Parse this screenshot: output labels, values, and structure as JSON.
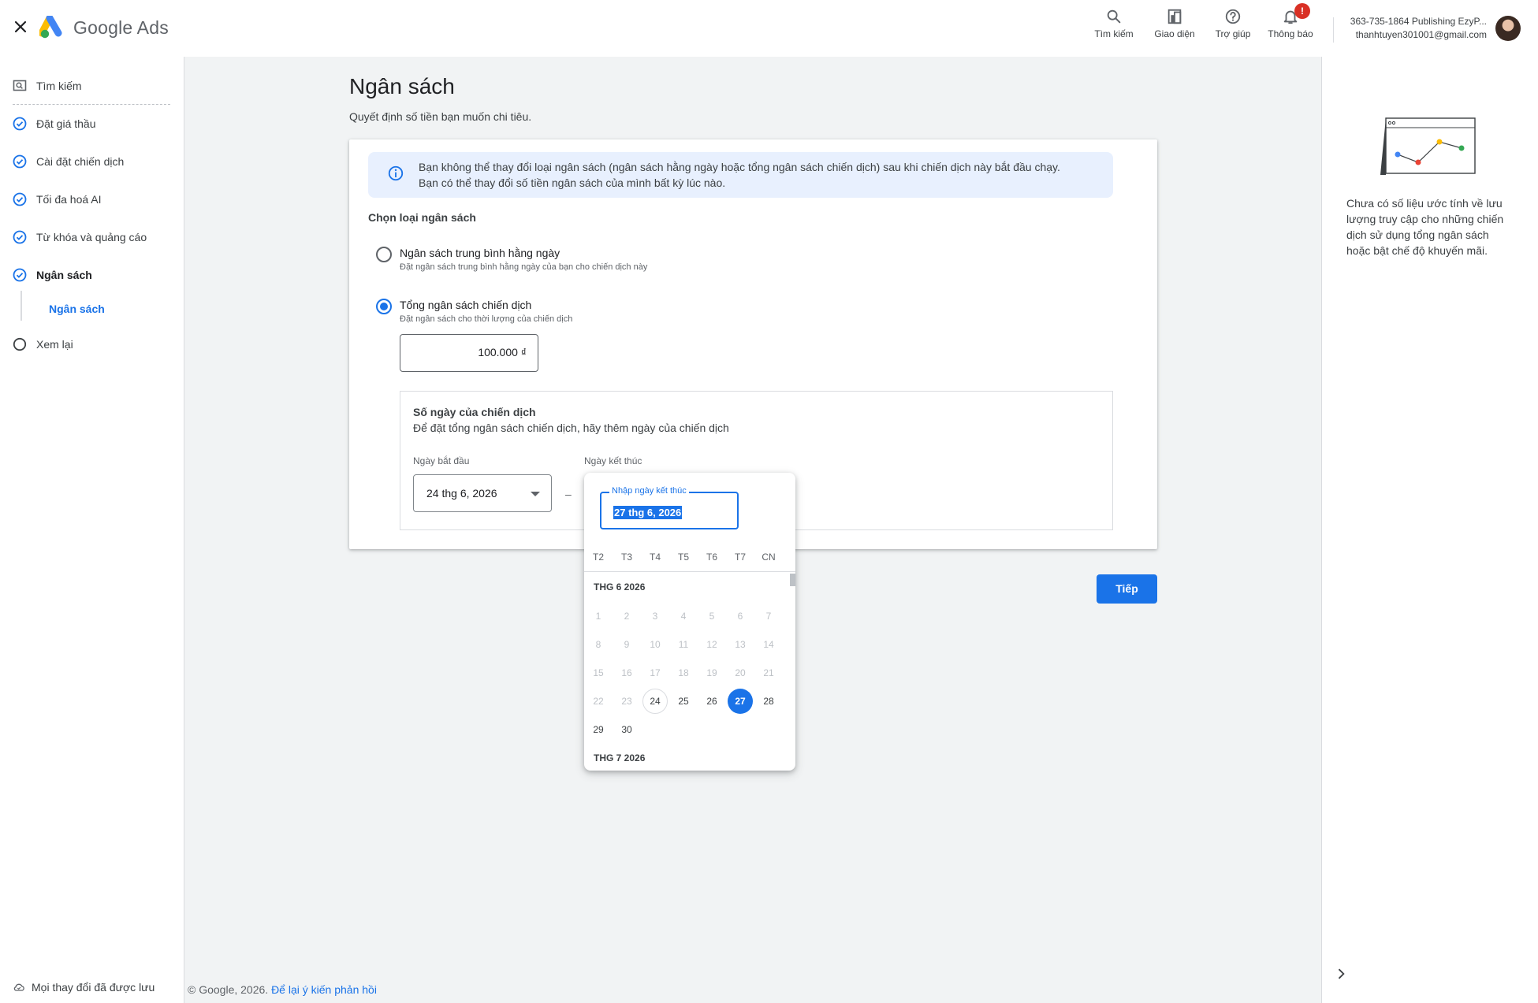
{
  "header": {
    "brand": "Google Ads",
    "actions": [
      {
        "label": "Tìm kiếm",
        "icon": "search-icon"
      },
      {
        "label": "Giao diện",
        "icon": "appearance-icon"
      },
      {
        "label": "Trợ giúp",
        "icon": "help-icon"
      },
      {
        "label": "Thông báo",
        "icon": "bell-icon",
        "badge": "!"
      }
    ],
    "account_name": "363-735-1864 Publishing EzyP...",
    "account_email": "thanhtuyen301001@gmail.com"
  },
  "sidebar": {
    "items": [
      {
        "label": "Tìm kiếm",
        "state": "search"
      },
      {
        "label": "Đặt giá thầu",
        "state": "done"
      },
      {
        "label": "Cài đặt chiến dịch",
        "state": "done"
      },
      {
        "label": "Tối đa hoá AI",
        "state": "done"
      },
      {
        "label": "Từ khóa và quảng cáo",
        "state": "done"
      },
      {
        "label": "Ngân sách",
        "state": "current"
      },
      {
        "label": "Xem lại",
        "state": "todo"
      }
    ],
    "subitem": "Ngân sách",
    "saved_status": "Mọi thay đổi đã được lưu"
  },
  "page": {
    "title": "Ngân sách",
    "subtitle": "Quyết định số tiền bạn muốn chi tiêu.",
    "info_line1": "Bạn không thể thay đổi loại ngân sách (ngân sách hằng ngày hoặc tổng ngân sách chiến dịch) sau khi chiến dịch này bắt đầu chạy.",
    "info_line2": "Bạn có thể thay đổi số tiền ngân sách của mình bất kỳ lúc nào.",
    "section_label": "Chọn loại ngân sách",
    "option1_label": "Ngân sách trung bình hằng ngày",
    "option1_desc": "Đặt ngân sách trung bình hằng ngày của bạn cho chiến dịch này",
    "option2_label": "Tổng ngân sách chiến dịch",
    "option2_desc": "Đặt ngân sách cho thời lượng của chiến dịch",
    "amount": "100.000 ₫",
    "days_title": "Số ngày của chiến dịch",
    "days_desc": "Để đặt tổng ngân sách chiến dịch, hãy thêm ngày của chiến dịch",
    "start_label": "Ngày bắt đầu",
    "end_label": "Ngày kết thúc",
    "start_value": "24 thg 6, 2026",
    "separator": "–",
    "next_button": "Tiếp"
  },
  "datepicker": {
    "input_label": "Nhập ngày kết thúc",
    "input_value": "27 thg 6, 2026",
    "weekdays": [
      "T2",
      "T3",
      "T4",
      "T5",
      "T6",
      "T7",
      "CN"
    ],
    "month1": "THG 6 2026",
    "month2": "THG 7 2026",
    "days": [
      "1",
      "2",
      "3",
      "4",
      "5",
      "6",
      "7",
      "8",
      "9",
      "10",
      "11",
      "12",
      "13",
      "14",
      "15",
      "16",
      "17",
      "18",
      "19",
      "20",
      "21",
      "22",
      "23",
      "24",
      "25",
      "26",
      "27",
      "28",
      "29",
      "30"
    ],
    "today": 24,
    "selected": 27
  },
  "right_panel": {
    "text": "Chưa có số liệu ước tính về lưu lượng truy cập cho những chiến dịch sử dụng tổng ngân sách hoặc bật chế độ khuyến mãi."
  },
  "footer": {
    "copyright": "© Google, 2026.",
    "feedback_link": "Để lại ý kiến phản hồi"
  },
  "colors": {
    "accent": "#1a73e8",
    "alert": "#d93025"
  }
}
